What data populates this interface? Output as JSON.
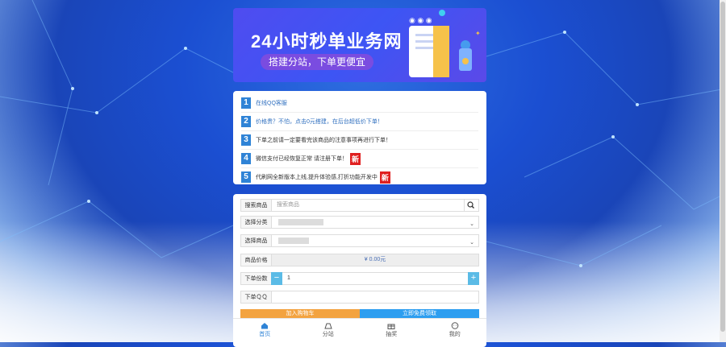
{
  "banner": {
    "title": "24小时秒单业务网",
    "subtitle": "搭建分站，下单更便宜"
  },
  "notices": [
    {
      "num": "1",
      "text": "在线QQ客服",
      "blue": true,
      "badge": ""
    },
    {
      "num": "2",
      "text": "价格贵？不怕，点击0元搭建，在后台超低价下单！",
      "blue": true,
      "badge": ""
    },
    {
      "num": "3",
      "text": "下单之前请一定要看完该商品的注意事项再进行下单！",
      "blue": false,
      "badge": ""
    },
    {
      "num": "4",
      "text": "微信支付已经恢复正常 请注册下单！",
      "blue": false,
      "badge": "新"
    },
    {
      "num": "5",
      "text": "代刷网全新版本上线,提升体验感,打折功能开发中",
      "blue": false,
      "badge": "新"
    }
  ],
  "form": {
    "search_label": "搜索商品",
    "search_placeholder": "搜索商品",
    "category_label": "选择分类",
    "product_label": "选择商品",
    "price_label": "商品价格",
    "price_value": "¥ 0.00元",
    "quantity_label": "下单份数",
    "quantity_value": "1",
    "minus": "−",
    "plus": "+",
    "qq_label": "下单ＱＱ",
    "add_cart": "加入购物车",
    "buy_now": "立即免费领取"
  },
  "nav": {
    "items": [
      {
        "label": "首页",
        "icon": "home-icon",
        "active": true
      },
      {
        "label": "分站",
        "icon": "site-icon",
        "active": false
      },
      {
        "label": "抽奖",
        "icon": "gift-icon",
        "active": false
      },
      {
        "label": "我的",
        "icon": "user-icon",
        "active": false
      }
    ]
  },
  "colors": {
    "accent": "#2f83d6",
    "cart": "#f3a340",
    "buy": "#2d9ef0",
    "badge": "#e02020"
  }
}
